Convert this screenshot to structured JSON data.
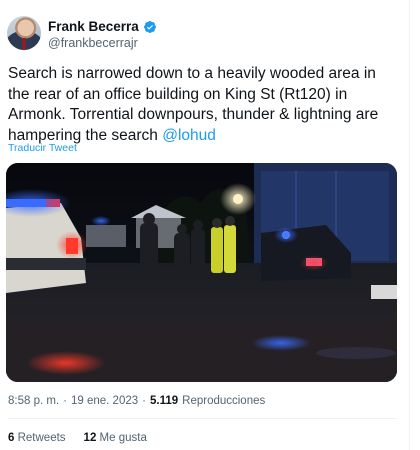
{
  "author": {
    "display_name": "Frank Becerra",
    "handle": "@frankbecerrajr",
    "verified": true,
    "verified_color": "#1d9bf0"
  },
  "tweet": {
    "text": "Search is narrowed down to a heavily wooded area in the rear of an office building on King St (Rt120) in Armonk. Torrential downpours, thunder & lightning are hampering the search ",
    "mention": "@lohud",
    "translate_label": "Traducir Tweet"
  },
  "meta": {
    "time": "8:58 p. m.",
    "separator": "·",
    "date": "19 ene. 2023",
    "views_count": "5.119",
    "views_label": "Reproducciones"
  },
  "stats": {
    "retweets_count": "6",
    "retweets_label": "Retweets",
    "likes_count": "12",
    "likes_label": "Me gusta"
  },
  "colors": {
    "link": "#1d9bf0",
    "text": "#0f1419",
    "secondary": "#536471"
  }
}
